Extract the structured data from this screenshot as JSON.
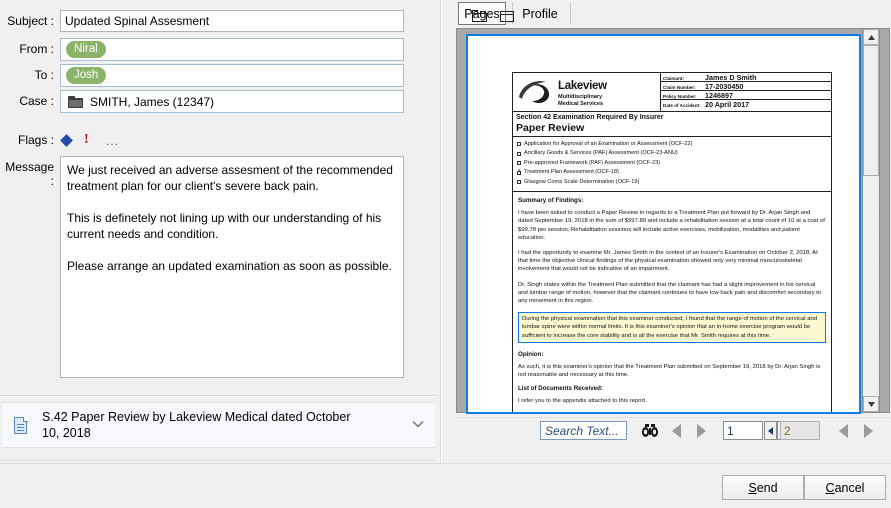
{
  "compose": {
    "fields": [
      {
        "label": "Subject :",
        "name": "subject",
        "value": "Updated Spinal Assesment"
      },
      {
        "label": "From :",
        "name": "from",
        "value": "Niral"
      },
      {
        "label": "To :",
        "name": "to",
        "value": "Josh"
      },
      {
        "label": "Case :",
        "name": "case",
        "value": "SMITH, James (12347)"
      }
    ],
    "flags": {
      "label": "Flags :",
      "items": [
        "diamond-flag-icon",
        "priority-exclamation-icon",
        "more-flags-ellipsis"
      ],
      "more_label": "..."
    },
    "message": {
      "label": "Message :",
      "value": "We just received an adverse assesment of the recommended treatment plan for our client's severe back pain.\n\nThis is definetely not lining up with our understanding of his current needs and condition.\n\nPlease arrange an updated examination as soon as possible."
    },
    "attachment": {
      "icon": "document-icon",
      "title": "S.42 Paper Review by Lakeview Medical dated October 10, 2018",
      "chevron": "chevron-down-icon"
    }
  },
  "viewer": {
    "tabs": [
      {
        "label": "Pages",
        "active": true
      },
      {
        "label": "Profile",
        "active": false
      }
    ],
    "toolbar": {
      "open_folder_icon": "folder-open-icon",
      "panel_icon": "window-panel-icon",
      "search_placeholder": "Search Text...",
      "search_value": "",
      "find_icon": "binoculars-icon",
      "prev_match_icon": "triangle-left-icon",
      "next_match_icon": "triangle-right-icon",
      "page_number": "1",
      "page_total": "2",
      "spin_down_icon": "spinner-left-icon",
      "spin_up_icon": "spinner-right-icon",
      "prev_page_icon": "triangle-left-icon",
      "next_page_icon": "triangle-right-icon"
    },
    "scrollbar": {
      "up_icon": "scroll-up-icon",
      "down_icon": "scroll-down-icon"
    }
  },
  "document": {
    "logo": {
      "name": "Lakeview",
      "sub_line_1": "Multidisciplinary",
      "sub_line_2": "Medical Services"
    },
    "claim_fields": [
      {
        "key": "Claimant:",
        "value": "James D Smith"
      },
      {
        "key": "Claim Number:",
        "value": "17-2030450"
      },
      {
        "key": "Policy Number:",
        "value": "1246897"
      },
      {
        "key": "Date of Accident:",
        "value": "20 April 2017"
      }
    ],
    "title_line_1": "Section 42 Examination Required By Insurer",
    "title_line_2": "Paper Review",
    "checkboxes": [
      {
        "label": "Application for Approval of an Examination or Assessment (OCF-22)",
        "checked": false
      },
      {
        "label": "Ancillary Goods & Services (PAF) Assessment (OCF-23-ANU)",
        "checked": false
      },
      {
        "label": "Pre-approved Framework (PAF) Assessment (OCF-23)",
        "checked": false
      },
      {
        "label": "Treatment Plan Assessment (OCF-18)",
        "checked": true
      },
      {
        "label": "Glasgow Coma Scale Determination (OCF-19)",
        "checked": false
      }
    ],
    "summary_heading": "Summary of Findings:",
    "summary_paragraphs": [
      "I have been asked to conduct a Paper Review in regards to a Treatment Plan put forward by Dr. Arjan Singh and dated September 19, 2018 in the sum of $997.80 and include a rehabilitation session at a total count of 10 at a cost of $99.78 per session. Rehabilitation sessions will include active exercises, mobilization, modalities and patient education.",
      "I had the opportunity to examine Mr. James Smith in the context of an Insurer's Examination on October 2, 2018.  At that time the objective clinical findings of the physical examination showed only very minimal musculoskeletal involvement that would not be indicative of an impairment.",
      "Dr. Singh states within the Treatment Plan submitted that the claimant has had a slight improvement in his cervical and lumbar range of motion, however that the claimant continues to have low back pain and discomfort secondary to any movement in this region."
    ],
    "highlighted_paragraph": "During the physical examination that this examiner conducted, I found that the range of motion of the cervical and lumbar spine were within normal limits. It is this examiner's opinion that an in-home exercise program would be sufficient to increase the core stability and is all the exercise that Mr. Smith requires at this time.",
    "opinion_heading": "Opinion:",
    "opinion_paragraph": "As such, it is this examiner's opinion that the Treatment Plan submitted on September 19, 2018 by Dr. Arjan Singh is not reasonable and necessary at this time.",
    "documents_heading": "List of Documents Received:",
    "documents_paragraph": "I refer you to the appendix attached to this report."
  },
  "footer": {
    "send": {
      "accel": "S",
      "rest": "end"
    },
    "cancel": {
      "accel": "C",
      "rest": "ancel"
    }
  },
  "colors": {
    "chip_green": "#8cb36a",
    "selection_blue": "#0c7ce6",
    "highlight_yellow": "#fbf8d2",
    "flag_red": "#b01020",
    "flag_blue": "#1f4fa8"
  }
}
